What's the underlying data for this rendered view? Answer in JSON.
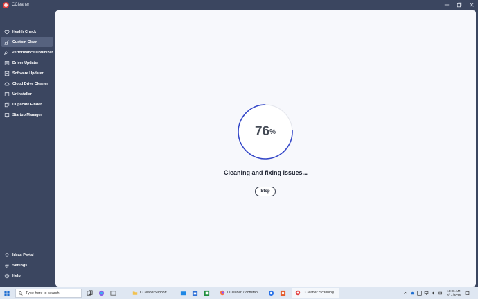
{
  "window": {
    "title": "CCleaner"
  },
  "sidebar": {
    "items": [
      {
        "label": "Health Check",
        "icon": "heart-icon"
      },
      {
        "label": "Custom Clean",
        "icon": "broom-icon",
        "active": true
      },
      {
        "label": "Performance Optimizer",
        "icon": "rocket-icon"
      },
      {
        "label": "Driver Updater",
        "icon": "driver-icon"
      },
      {
        "label": "Software Updater",
        "icon": "software-updater-icon"
      },
      {
        "label": "Cloud Drive Cleaner",
        "icon": "cloud-icon"
      },
      {
        "label": "Uninstaller",
        "icon": "uninstaller-icon"
      },
      {
        "label": "Duplicate Finder",
        "icon": "duplicate-icon"
      },
      {
        "label": "Startup Manager",
        "icon": "startup-icon"
      }
    ],
    "bottom_items": [
      {
        "label": "Ideas Portal",
        "icon": "lightbulb-icon"
      },
      {
        "label": "Settings",
        "icon": "gear-icon"
      },
      {
        "label": "Help",
        "icon": "help-icon"
      }
    ]
  },
  "main": {
    "progress_value": "76",
    "progress_unit": "%",
    "progress_fraction": 0.76,
    "status": "Cleaning and fixing issues...",
    "stop_label": "Stop",
    "accent_color": "#3346c8"
  },
  "taskbar": {
    "search_placeholder": "Type here to search",
    "apps": [
      {
        "label": "CCleanerSupport",
        "icon": "folder-icon"
      },
      {
        "label": "CCleaner 7 constan...",
        "icon": "firefox-icon"
      },
      {
        "label": "CCleaner: Scanning...",
        "icon": "ccleaner-icon"
      }
    ],
    "clock_time": "10:06 AM",
    "clock_date": "1/14/2026"
  }
}
